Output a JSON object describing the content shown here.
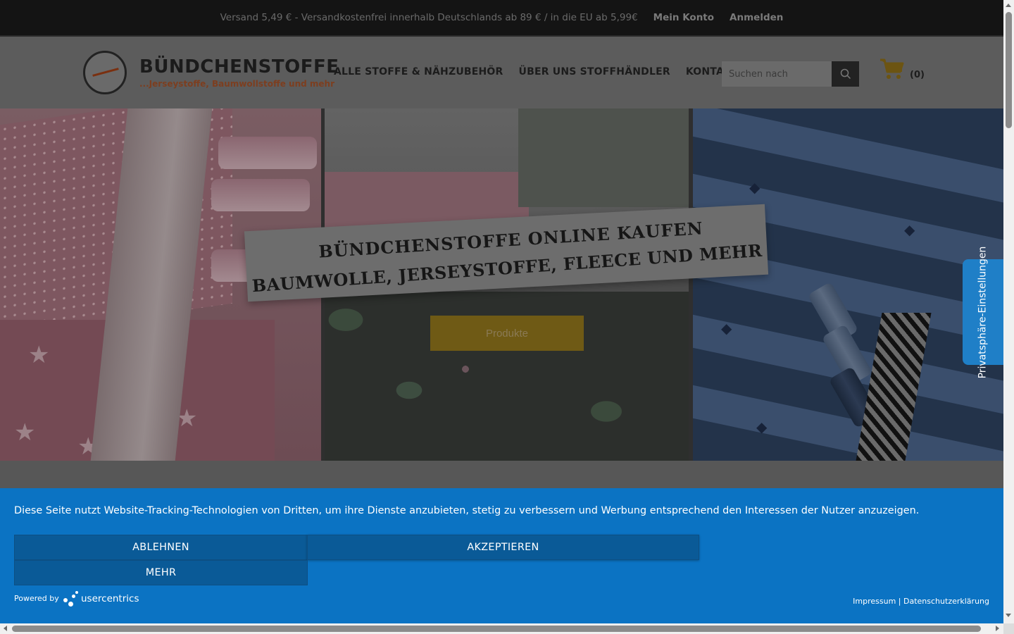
{
  "topbar": {
    "shipping_text": "Versand 5,49 € - Versandkostenfrei innerhalb Deutschlands ab 89 € / in die EU ab 5,99€",
    "account_link": "Mein Konto",
    "login_link": "Anmelden"
  },
  "header": {
    "logo_title": "BÜNDCHENSTOFFE",
    "logo_subtitle": "...Jerseystoffe, Baumwollstoffe und mehr",
    "nav": [
      {
        "label": "ALLE STOFFE & NÄHZUBEHÖR"
      },
      {
        "label": "ÜBER UNS STOFFHÄNDLER"
      },
      {
        "label": "KONTAKT"
      }
    ],
    "search_placeholder": "Suchen nach",
    "cart_count": "(0)"
  },
  "hero": {
    "headline_line1": "BÜNDCHENSTOFFE ONLINE KAUFEN",
    "headline_line2": "BAUMWOLLE, JERSEYSTOFFE, FLEECE UND MEHR",
    "cta_label": "Produkte"
  },
  "privacy_tab": {
    "label": "Privatsphäre-Einstellungen"
  },
  "cookie_banner": {
    "message": "Diese Seite nutzt Website-Tracking-Technologien von Dritten, um ihre Dienste anzubieten, stetig zu verbessern und Werbung entsprechend den Interessen der Nutzer anzuzeigen.",
    "decline_label": "ABLEHNEN",
    "accept_label": "AKZEPTIEREN",
    "more_label": "MEHR",
    "powered_by": "Powered by",
    "brand": "usercentrics",
    "imprint_link": "Impressum",
    "separator": "|",
    "privacy_link": "Datenschutzerklärung"
  },
  "colors": {
    "cookie_bg": "#0b73c3",
    "privacy_tab_bg": "#1f7fc7",
    "cta_bg": "#6f5a15"
  }
}
